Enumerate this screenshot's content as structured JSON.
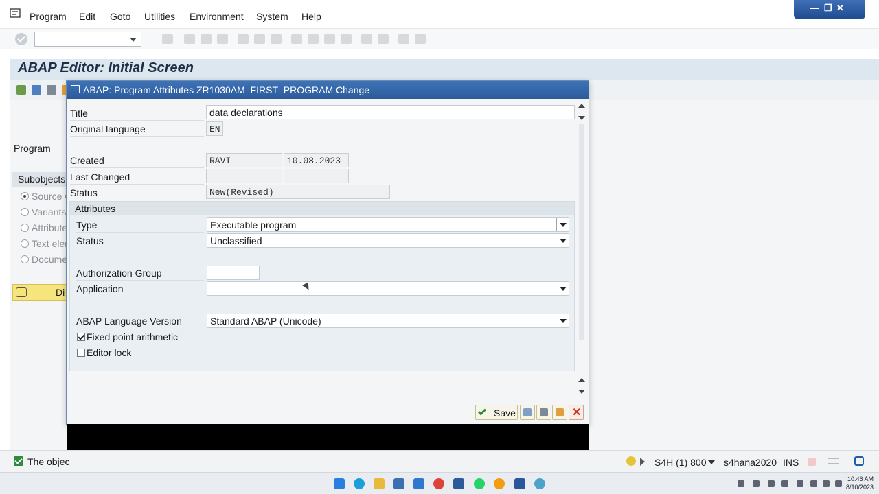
{
  "menubar": {
    "items": [
      "Program",
      "Edit",
      "Goto",
      "Utilities",
      "Environment",
      "System",
      "Help"
    ]
  },
  "window_controls": [
    "minimize-icon",
    "restore-icon",
    "close-icon"
  ],
  "screen": {
    "title": "ABAP Editor: Initial Screen",
    "program_label": "Program",
    "subobjects_label": "Subobjects",
    "subobjects": [
      "Source C",
      "Variants",
      "Attribute",
      "Text elen",
      "Documen"
    ],
    "display_button": "Di"
  },
  "dialog": {
    "title": "ABAP: Program Attributes ZR1030AM_FIRST_PROGRAM Change",
    "fields": {
      "title_label": "Title",
      "title_value": "data declarations",
      "orig_lang_label": "Original language",
      "orig_lang_value": "EN",
      "created_label": "Created",
      "created_by": "RAVI",
      "created_date": "10.08.2023",
      "last_changed_label": "Last Changed",
      "status_label": "Status",
      "status_value": "New(Revised)"
    },
    "attributes": {
      "header": "Attributes",
      "type_label": "Type",
      "type_value": "Executable program",
      "status_label": "Status",
      "status_value": "Unclassified",
      "auth_group_label": "Authorization Group",
      "application_label": "Application",
      "abap_version_label": "ABAP Language Version",
      "abap_version_value": "Standard ABAP (Unicode)",
      "fixed_point_label": "Fixed point arithmetic",
      "fixed_point_checked": true,
      "editor_lock_label": "Editor lock",
      "editor_lock_checked": false
    },
    "buttons": {
      "save": "Save"
    }
  },
  "statusbar": {
    "message": "The objec",
    "system": "S4H (1) 800",
    "server": "s4hana2020",
    "mode": "INS"
  },
  "taskbar": {
    "time": "10:46 AM",
    "date": "8/10/2023"
  },
  "colors": {
    "dialog_title": "#2c5b9a",
    "screen_title_bg": "#dde7f0",
    "save_check": "#2e8b3a",
    "cancel": "#d0331a"
  }
}
